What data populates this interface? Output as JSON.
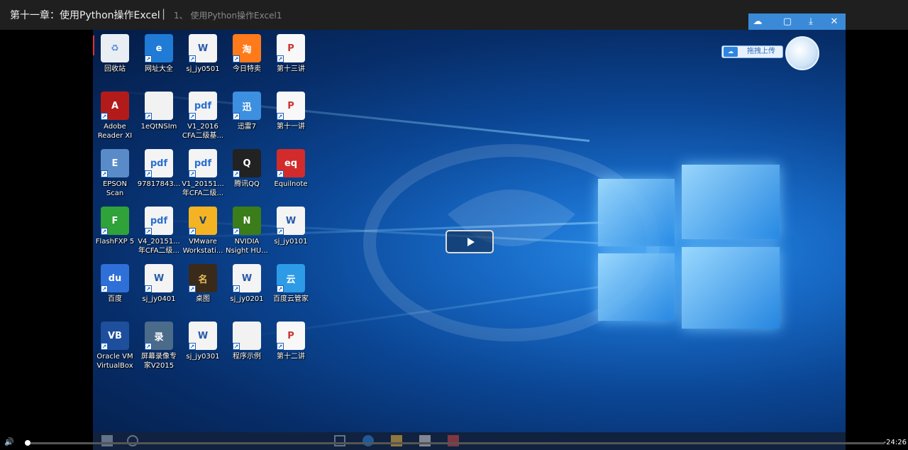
{
  "header": {
    "title": "第十一章：使用Python操作Excel",
    "separator": "|",
    "subtitle": "1、 使用Python操作Excel1"
  },
  "desktop_icons": [
    {
      "label": "回收站",
      "icon": "recycle-bin-icon"
    },
    {
      "label": "网址大全",
      "icon": "ie-icon"
    },
    {
      "label": "sj_jy0501",
      "icon": "word-doc-icon"
    },
    {
      "label": "今日特卖",
      "icon": "taobao-icon"
    },
    {
      "label": "第十三讲",
      "icon": "ppt-icon"
    },
    {
      "label": "Adobe\nReader XI",
      "icon": "adobe-reader-icon"
    },
    {
      "label": "1eQtNSIm",
      "icon": "blank-file-icon"
    },
    {
      "label": "V1_2016\nCFA二级基...",
      "icon": "pdf-icon"
    },
    {
      "label": "迅雷7",
      "icon": "xunlei-icon"
    },
    {
      "label": "第十一讲",
      "icon": "ppt-icon"
    },
    {
      "label": "EPSON\nScan",
      "icon": "epson-scan-icon"
    },
    {
      "label": "97817843...",
      "icon": "pdf-icon"
    },
    {
      "label": "V1_20151...\n年CFA二级...",
      "icon": "pdf-icon"
    },
    {
      "label": "腾讯QQ",
      "icon": "qq-icon"
    },
    {
      "label": "Equilnote",
      "icon": "equilnote-icon"
    },
    {
      "label": "FlashFXP 5",
      "icon": "flashfxp-icon"
    },
    {
      "label": "V4_20151...\n年CFA二级...",
      "icon": "pdf-icon"
    },
    {
      "label": "VMware\nWorkstati...",
      "icon": "vmware-icon"
    },
    {
      "label": "NVIDIA\nNsight HU...",
      "icon": "nvidia-icon"
    },
    {
      "label": "sj_jy0101",
      "icon": "word-doc-icon"
    },
    {
      "label": "百度",
      "icon": "baidu-icon"
    },
    {
      "label": "sj_jy0401",
      "icon": "word-doc-icon"
    },
    {
      "label": "桌图",
      "icon": "zhutu-icon"
    },
    {
      "label": "sj_jy0201",
      "icon": "word-doc-icon"
    },
    {
      "label": "百度云管家",
      "icon": "baidu-cloud-icon"
    },
    {
      "label": "Oracle VM\nVirtualBox",
      "icon": "virtualbox-icon"
    },
    {
      "label": "屏幕录像专\n家V2015",
      "icon": "screen-recorder-icon"
    },
    {
      "label": "sj_jy0301",
      "icon": "word-doc-icon"
    },
    {
      "label": "程序示例",
      "icon": "blank-file-icon"
    },
    {
      "label": "第十二讲",
      "icon": "ppt-icon"
    }
  ],
  "upload_widget": {
    "label": "拖拽上传"
  },
  "window_buttons": [
    "restore-icon",
    "download-icon",
    "close-icon"
  ],
  "player": {
    "time": "-24:26",
    "progress": 0.0
  }
}
